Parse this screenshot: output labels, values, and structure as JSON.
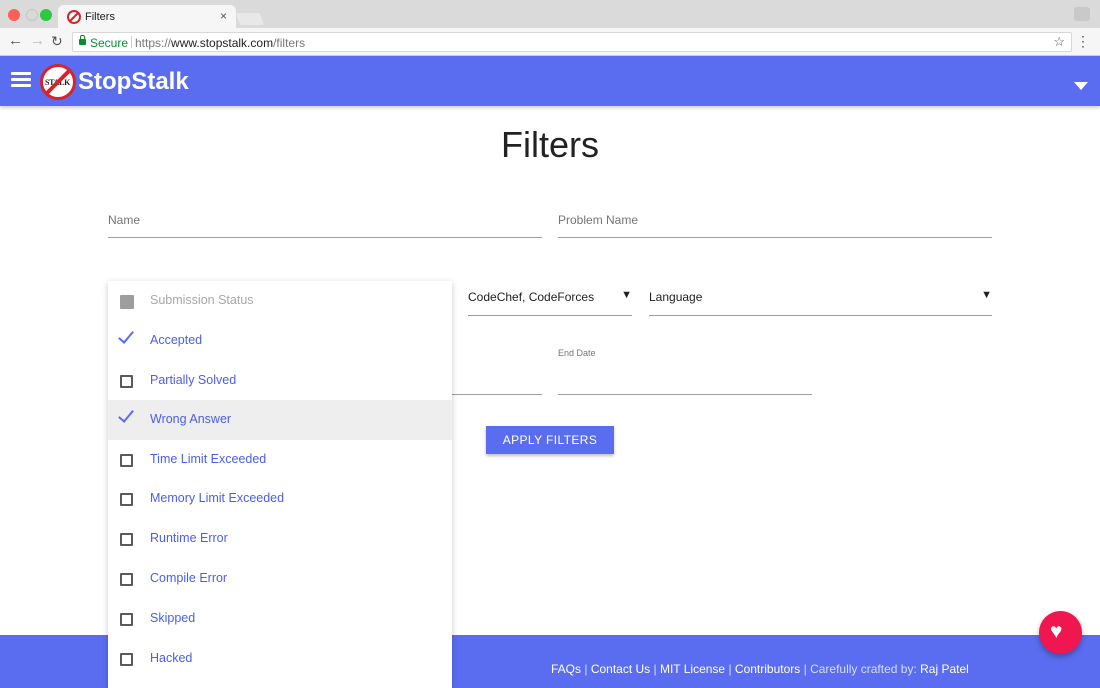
{
  "browser": {
    "tab_title": "Filters",
    "tab_close": "×",
    "secure_label": "Secure",
    "url_scheme": "https://",
    "url_host": "www.stopstalk.com",
    "url_path": "/filters",
    "back_icon": "←",
    "forward_icon": "→",
    "reload_icon": "↻",
    "star_icon": "☆",
    "menu_icon": "⋮"
  },
  "nav": {
    "brand": "StopStalk",
    "logo_text": "STALK",
    "accent_color": "#5a6df0",
    "logo_color": "#d8232a"
  },
  "page": {
    "title": "Filters"
  },
  "form": {
    "name_placeholder": "Name",
    "problem_placeholder": "Problem Name",
    "sites_value": "CodeChef, CodeForces",
    "language_value": "Language",
    "end_date_label": "End Date",
    "apply_label": "APPLY FILTERS"
  },
  "dropdown": {
    "items": [
      {
        "label": "Submission Status",
        "state": "disabled"
      },
      {
        "label": "Accepted",
        "state": "checked"
      },
      {
        "label": "Partially Solved",
        "state": "unchecked"
      },
      {
        "label": "Wrong Answer",
        "state": "checked"
      },
      {
        "label": "Time Limit Exceeded",
        "state": "unchecked"
      },
      {
        "label": "Memory Limit Exceeded",
        "state": "unchecked"
      },
      {
        "label": "Runtime Error",
        "state": "unchecked"
      },
      {
        "label": "Compile Error",
        "state": "unchecked"
      },
      {
        "label": "Skipped",
        "state": "unchecked"
      },
      {
        "label": "Hacked",
        "state": "unchecked"
      }
    ]
  },
  "footer": {
    "faqs": "FAQs",
    "contact": "Contact Us",
    "license": "MIT License",
    "contributors": "Contributors",
    "sep": " | ",
    "crafted": "Carefully crafted by:",
    "author": "Raj Patel",
    "fab_icon": "♥",
    "fab_color": "#f0164f"
  }
}
